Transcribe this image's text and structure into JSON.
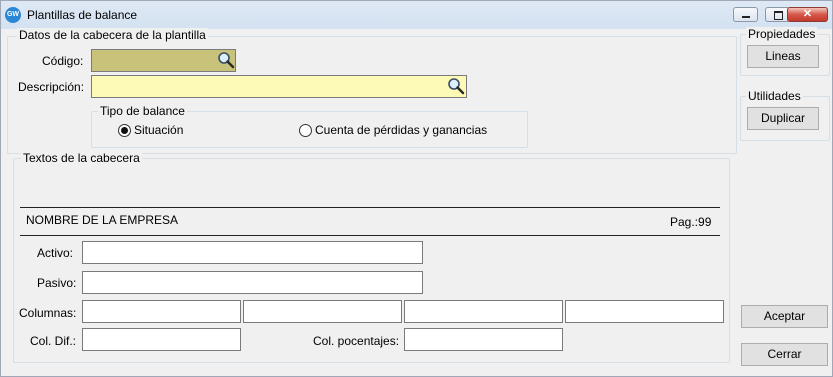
{
  "window": {
    "title": "Plantillas de balance",
    "app_icon_text": "GW",
    "close_glyph": "✕"
  },
  "header_group": {
    "legend": "Datos de la cabecera de la plantilla",
    "codigo_label": "Código:",
    "codigo_value": "",
    "descripcion_label": "Descripción:",
    "descripcion_value": "",
    "codigo_bg": "#c8c27a",
    "descripcion_bg": "#fdf9b6"
  },
  "tipo_balance": {
    "legend": "Tipo de balance",
    "options": [
      {
        "label": "Situación",
        "selected": true
      },
      {
        "label": "Cuenta de pérdidas y ganancias",
        "selected": false
      }
    ]
  },
  "textos_group": {
    "legend": "Textos de la cabecera",
    "company_name": "NOMBRE DE LA EMPRESA",
    "page_text": "Pag.:99",
    "activo_label": "Activo:",
    "activo_value": "",
    "pasivo_label": "Pasivo:",
    "pasivo_value": "",
    "columnas_label": "Columnas:",
    "columnas_values": [
      "",
      "",
      "",
      ""
    ],
    "col_dif_label": "Col. Dif.:",
    "col_dif_value": "",
    "col_porcentajes_label": "Col. pocentajes:",
    "col_porcentajes_value": ""
  },
  "propiedades": {
    "legend": "Propiedades",
    "lineas_button": "Lineas"
  },
  "utilidades": {
    "legend": "Utilidades",
    "duplicar_button": "Duplicar"
  },
  "footer": {
    "aceptar_button": "Aceptar",
    "cerrar_button": "Cerrar"
  }
}
